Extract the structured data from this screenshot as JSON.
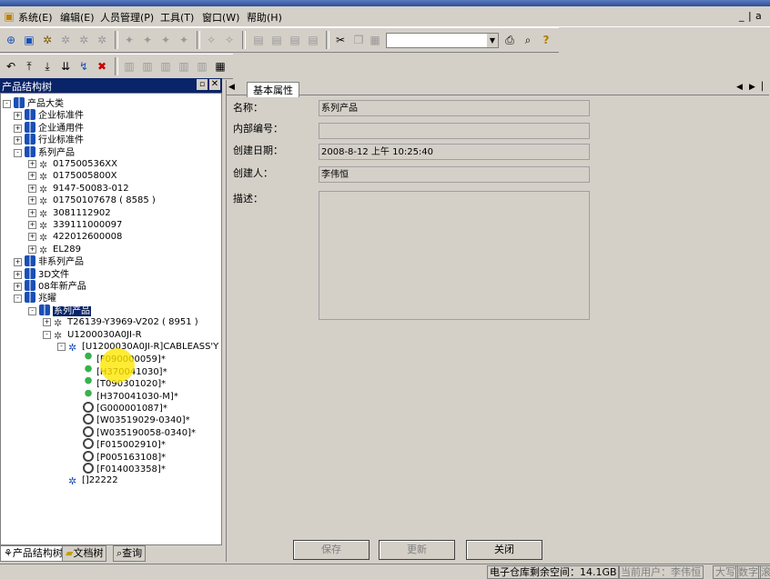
{
  "menu": [
    "系统(E)",
    "编辑(E)",
    "人员管理(P)",
    "工具(T)",
    "窗口(W)",
    "帮助(H)"
  ],
  "window_controls": [
    "_",
    "|",
    "a"
  ],
  "left_panel": {
    "title": "产品结构树",
    "tree": [
      {
        "label": "产品大类",
        "level": 0,
        "exp": "-",
        "icon": "book"
      },
      {
        "label": "企业标准件",
        "level": 1,
        "exp": "+",
        "icon": "book"
      },
      {
        "label": "企业通用件",
        "level": 1,
        "exp": "+",
        "icon": "book"
      },
      {
        "label": "行业标准件",
        "level": 1,
        "exp": "+",
        "icon": "book"
      },
      {
        "label": "系列产品",
        "level": 1,
        "exp": "-",
        "icon": "book"
      },
      {
        "label": "017500536XX",
        "level": 2,
        "exp": "+",
        "icon": "gears"
      },
      {
        "label": "0175005800X",
        "level": 2,
        "exp": "+",
        "icon": "gears"
      },
      {
        "label": "9147-50083-012",
        "level": 2,
        "exp": "+",
        "icon": "gears"
      },
      {
        "label": "01750107678 ( 8585 )",
        "level": 2,
        "exp": "+",
        "icon": "gears"
      },
      {
        "label": "3081112902",
        "level": 2,
        "exp": "+",
        "icon": "gears"
      },
      {
        "label": "339111000097",
        "level": 2,
        "exp": "+",
        "icon": "gears"
      },
      {
        "label": "422012600008",
        "level": 2,
        "exp": "+",
        "icon": "gears"
      },
      {
        "label": "EL289",
        "level": 2,
        "exp": "+",
        "icon": "gears"
      },
      {
        "label": "非系列产品",
        "level": 1,
        "exp": "+",
        "icon": "book"
      },
      {
        "label": "3D文件",
        "level": 1,
        "exp": "+",
        "icon": "book"
      },
      {
        "label": "08年新产品",
        "level": 1,
        "exp": "+",
        "icon": "book"
      },
      {
        "label": "兆曜",
        "level": 1,
        "exp": "-",
        "icon": "book"
      },
      {
        "label": "系列产品",
        "level": 2,
        "exp": "-",
        "icon": "book",
        "selected": true
      },
      {
        "label": "T26139-Y3969-V202 ( 8951 )",
        "level": 3,
        "exp": "+",
        "icon": "gears"
      },
      {
        "label": "U1200030A0JI-R",
        "level": 3,
        "exp": "-",
        "icon": "gears"
      },
      {
        "label": "[U1200030A0JI-R]CABLEASS'Y",
        "level": 4,
        "exp": "-",
        "icon": "part"
      },
      {
        "label": "[F090000059]*",
        "level": 5,
        "exp": "",
        "icon": "pin"
      },
      {
        "label": "[H370041030]*",
        "level": 5,
        "exp": "",
        "icon": "pin"
      },
      {
        "label": "[T090301020]*",
        "level": 5,
        "exp": "",
        "icon": "pin"
      },
      {
        "label": "[H370041030-M]*",
        "level": 5,
        "exp": "",
        "icon": "pin"
      },
      {
        "label": "[G000001087]*",
        "level": 5,
        "exp": "",
        "icon": "gear"
      },
      {
        "label": "[W03519029-0340]*",
        "level": 5,
        "exp": "",
        "icon": "gear"
      },
      {
        "label": "[W035190058-0340]*",
        "level": 5,
        "exp": "",
        "icon": "gear"
      },
      {
        "label": "[F015002910]*",
        "level": 5,
        "exp": "",
        "icon": "gear"
      },
      {
        "label": "[P005163108]*",
        "level": 5,
        "exp": "",
        "icon": "gear"
      },
      {
        "label": "[F014003358]*",
        "level": 5,
        "exp": "",
        "icon": "gear"
      },
      {
        "label": "[]22222",
        "level": 4,
        "exp": "",
        "icon": "part"
      }
    ],
    "bottom_tabs": [
      "产品结构树",
      "文档树",
      "查询"
    ]
  },
  "right_panel": {
    "tab": "基本属性",
    "fields": [
      {
        "label": "名称：",
        "value": "系列产品"
      },
      {
        "label": "内部编号：",
        "value": ""
      },
      {
        "label": "创建日期：",
        "value": "2008-8-12 上午 10:25:40"
      },
      {
        "label": "创建人：",
        "value": "李伟恒"
      },
      {
        "label": "描述：",
        "value": ""
      }
    ],
    "buttons": {
      "save": "保存",
      "update": "更新",
      "close": "关闭"
    }
  },
  "status": {
    "space": "电子仓库剩余空间：14.1GB",
    "user": "当前用户：李伟恒",
    "caps": "大写",
    "num": "数字",
    "scroll": "滚"
  },
  "colors": {
    "selection": "#0a246a",
    "face": "#d4d0c8"
  }
}
